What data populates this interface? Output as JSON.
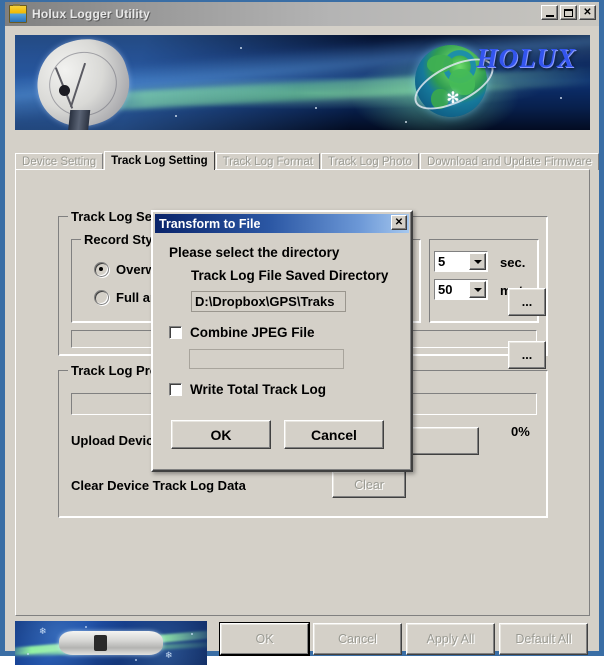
{
  "window": {
    "title": "Holux Logger Utility",
    "icon": "battery-device-icon",
    "minimize_label": "–",
    "maximize_label": "□",
    "close_label": "✕"
  },
  "banner": {
    "brand": "HOLUX",
    "dish_icon": "satellite-dish-icon",
    "globe_icon": "globe-icon"
  },
  "tabs": [
    {
      "label": "Device Setting",
      "active": false
    },
    {
      "label": "Track Log Setting",
      "active": true
    },
    {
      "label": "Track Log Format",
      "active": false
    },
    {
      "label": "Track Log Photo",
      "active": false
    },
    {
      "label": "Download and Update Firmware",
      "active": false
    }
  ],
  "track_log_setting": {
    "group_title": "Track Log Setting",
    "record_style": {
      "group_title": "Record Style",
      "options": [
        {
          "label": "Overwrite",
          "selected": true
        },
        {
          "label": "Full and Stop",
          "selected": false
        }
      ]
    },
    "interval": {
      "value": "5",
      "unit": "sec."
    },
    "distance": {
      "value": "50",
      "unit": "meter"
    }
  },
  "track_log_process": {
    "group_title": "Track Log Process",
    "progress_percent": "0%",
    "upload_label": "Upload Device Track Log Data",
    "clear_label": "Clear Device Track Log Data",
    "clear_button": "Clear"
  },
  "dialog": {
    "title": "Transform to File",
    "close_label": "✕",
    "prompt": "Please select the directory",
    "directory_label": "Track Log File Saved Directory",
    "directory_value": "D:\\Dropbox\\GPS\\Traks",
    "browse_label": "...",
    "browse2_label": "...",
    "combine_jpeg": {
      "label": "Combine JPEG File",
      "checked": false
    },
    "jpeg_path_value": "",
    "write_total": {
      "label": "Write Total Track Log",
      "checked": false
    },
    "ok_label": "OK",
    "cancel_label": "Cancel"
  },
  "bottom_bar": {
    "device_image": "gps-device-photo",
    "buttons": [
      {
        "label": "OK",
        "disabled": true
      },
      {
        "label": "Cancel",
        "disabled": true
      },
      {
        "label": "Apply All",
        "disabled": true
      },
      {
        "label": "Default All",
        "disabled": true
      }
    ]
  },
  "colors": {
    "frame_blue": "#3a6ea5",
    "face": "#d4d0c8",
    "dialog_title_start": "#0a246a",
    "dialog_title_end": "#a6c8ef",
    "brand_blue": "#3355ee"
  }
}
